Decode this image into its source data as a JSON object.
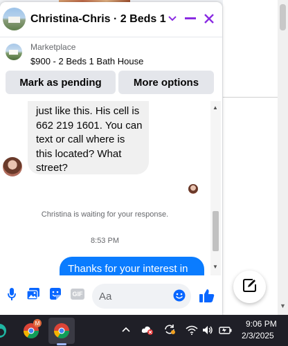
{
  "header": {
    "title": "Christina-Chris · 2 Beds 1 B..."
  },
  "listing": {
    "source": "Marketplace",
    "title": "$900 - 2 Beds 1 Bath House"
  },
  "actions": {
    "mark_pending": "Mark as pending",
    "more_options": "More options"
  },
  "messages": {
    "incoming_lines": [
      "just like this.  His cell is",
      "662 219 1601. You can",
      "text or call where is",
      "this located? What",
      "street?"
    ],
    "waiting_notice": "Christina is waiting for your response.",
    "timestamp": "8:53 PM",
    "outgoing_text": "Thanks for your interest in"
  },
  "composer": {
    "placeholder": "Aa",
    "gif_label": "GIF"
  },
  "taskbar": {
    "badge": "M",
    "time": "9:06 PM",
    "date": "2/3/2025"
  },
  "colors": {
    "accent": "#8a2be2",
    "messenger_blue": "#0a7cff",
    "taskbar": "#1f1f27"
  }
}
